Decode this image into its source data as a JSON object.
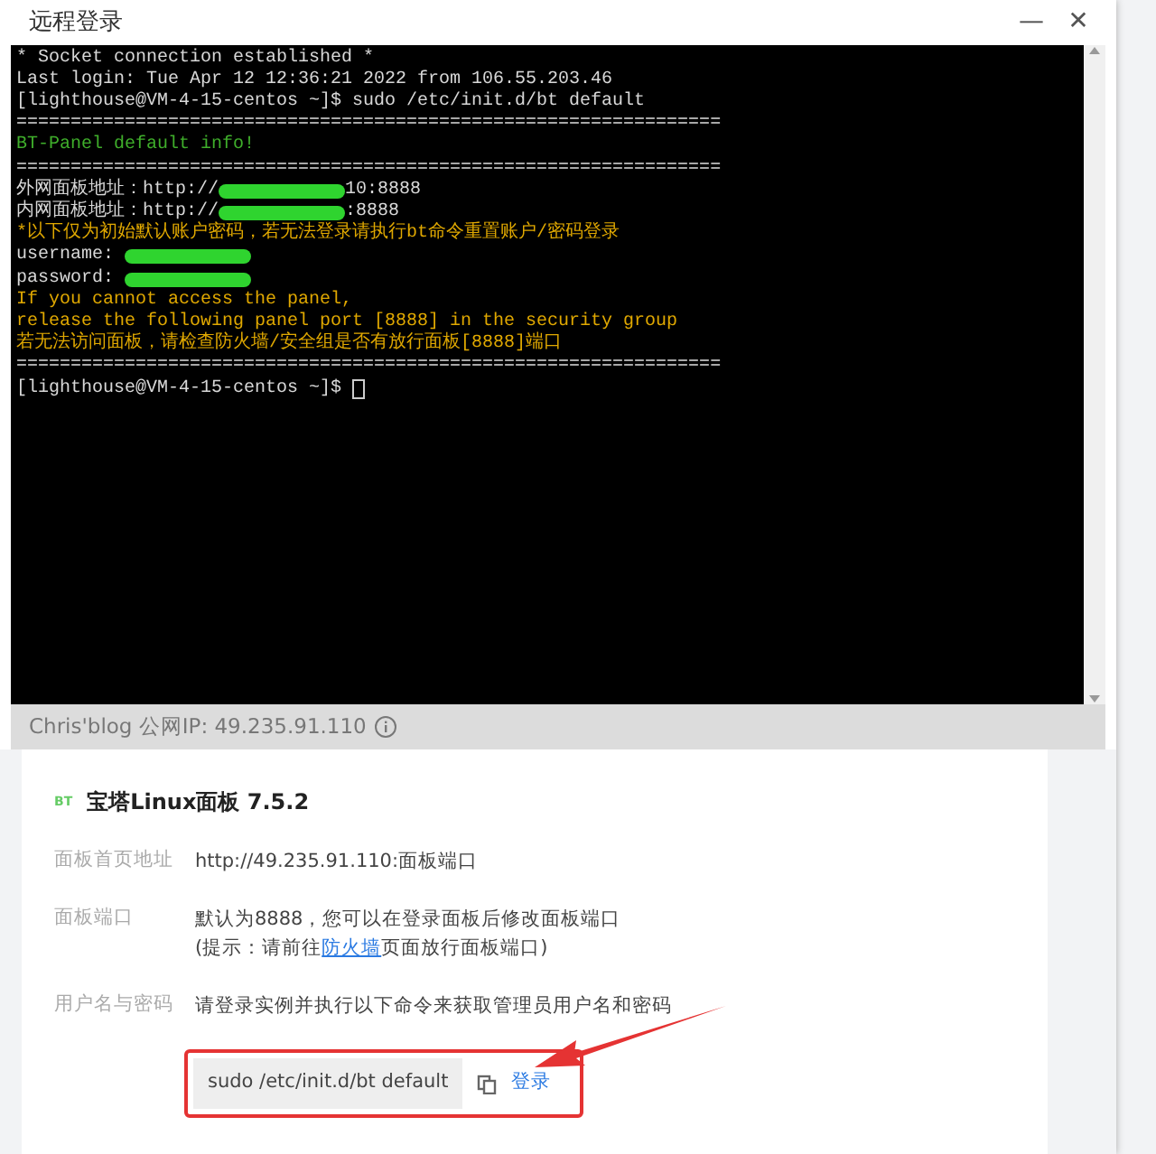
{
  "window": {
    "title": "远程登录",
    "buttons": [
      "—",
      "✕"
    ]
  },
  "terminal": {
    "lines": [
      {
        "kind": "plain",
        "text": "* Socket connection established *"
      },
      {
        "kind": "plain",
        "text": "Last login: Tue Apr 12 12:36:21 2022 from 106.55.203.46"
      },
      {
        "kind": "plain",
        "text": "[lighthouse@VM-4-15-centos ~]$ sudo /etc/init.d/bt default"
      },
      {
        "kind": "plain",
        "text": "================================================================="
      },
      {
        "kind": "green",
        "text": "BT-Panel default info!"
      },
      {
        "kind": "plain",
        "text": "================================================================="
      },
      {
        "kind": "redacted",
        "text": "外网面板地址：http://",
        "after": "10:8888"
      },
      {
        "kind": "redacted",
        "text": "内网面板地址：http://",
        "after": ":8888"
      },
      {
        "kind": "yellow",
        "text": "*以下仅为初始默认账户密码，若无法登录请执行bt命令重置账户/密码登录"
      },
      {
        "kind": "redacted",
        "text": "username: "
      },
      {
        "kind": "redacted",
        "text": "password: "
      },
      {
        "kind": "yellow",
        "text": "If you cannot access the panel,"
      },
      {
        "kind": "yellow",
        "text": "release the following panel port [8888] in the security group"
      },
      {
        "kind": "yellow",
        "text": "若无法访问面板，请检查防火墙/安全组是否有放行面板[8888]端口"
      },
      {
        "kind": "plain",
        "text": "================================================================="
      },
      {
        "kind": "prompt",
        "text": "[lighthouse@VM-4-15-centos ~]$ "
      }
    ]
  },
  "status_bar": {
    "text": "Chris'blog 公网IP: 49.235.91.110"
  },
  "panel": {
    "logo": "BT",
    "title": "宝塔Linux面板 7.5.2",
    "fields": [
      {
        "label": "面板首页地址",
        "lines": [
          "http://49.235.91.110:面板端口"
        ]
      },
      {
        "label": "面板端口",
        "lines": [
          "默认为8888，您可以在登录面板后修改面板端口",
          {
            "text": "(提示：请前往",
            "link": "防火墙",
            "rest": "页面放行面板端口)"
          }
        ]
      },
      {
        "label": "用户名与密码",
        "lines": [
          "请登录实例并执行以下命令来获取管理员用户名和密码"
        ]
      }
    ],
    "command": "sudo /etc/init.d/bt default",
    "login": "登录"
  }
}
